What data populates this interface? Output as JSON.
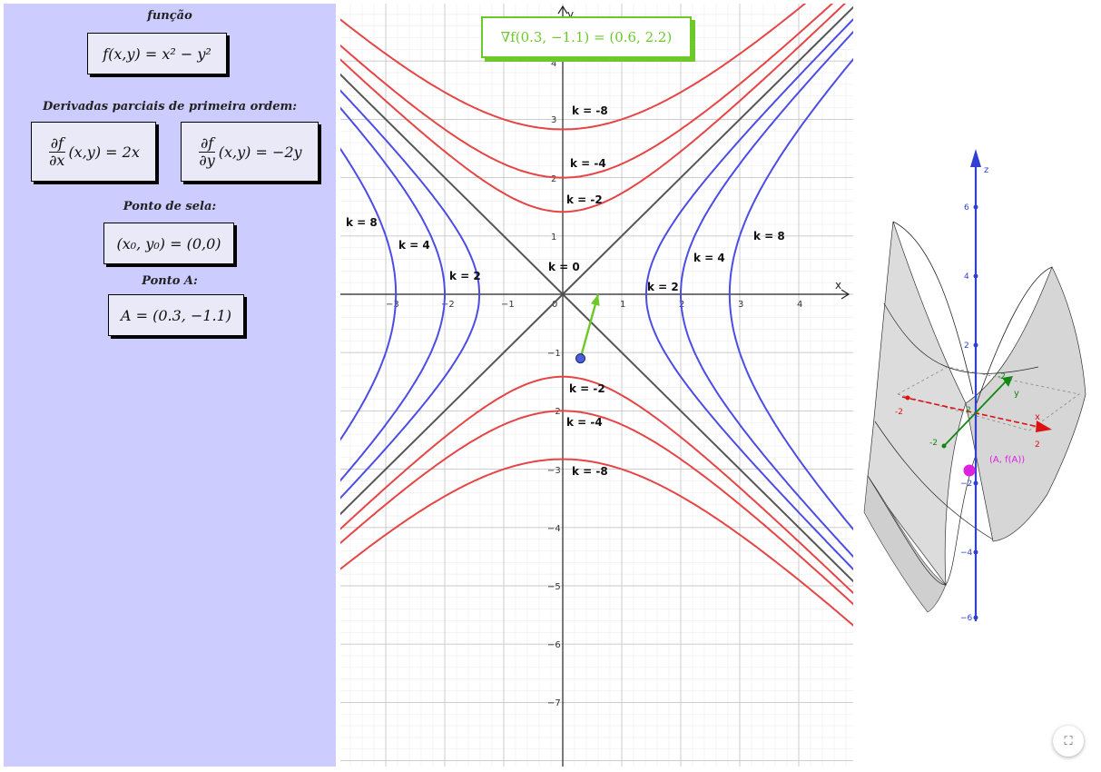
{
  "left_panel": {
    "caption_function": "função",
    "function_formula": "f(x,y) = x² − y²",
    "caption_partials": "Derivadas parciais de primeira ordem:",
    "partial_x": {
      "num": "∂f",
      "den": "∂x",
      "rest": "(x,y) = 2x"
    },
    "partial_y": {
      "num": "∂f",
      "den": "∂y",
      "rest": "(x,y) = −2y"
    },
    "caption_saddle": "Ponto de sela:",
    "saddle_formula": "(x₀, y₀) = (0,0)",
    "caption_point_a": "Ponto A:",
    "point_a_formula": "A = (0.3, −1.1)"
  },
  "graph2d": {
    "gradient_label": "∇f(0.3, −1.1)  = (0.6, 2.2)",
    "axis_x_label": "x",
    "axis_y_label": "y",
    "x_ticks": [
      "−3",
      "−2",
      "−1",
      "0",
      "1",
      "2",
      "3",
      "4"
    ],
    "y_ticks": [
      "4",
      "3",
      "2",
      "1",
      "−1",
      "−2",
      "−3",
      "−4",
      "−5",
      "−6",
      "−7"
    ],
    "level_labels": [
      "k = -8",
      "k = -4",
      "k = -2",
      "k = 8",
      "k = 4",
      "k = 2",
      "k = 0",
      "k = 2",
      "k = 4",
      "k = 8",
      "k = -2",
      "k = -4",
      "k = -8"
    ],
    "colors": {
      "positive": "#4c4ce6",
      "negative": "#e64545",
      "zero": "#555555",
      "gradient": "#6dc82a",
      "point": "#4c5fd6"
    },
    "point_a": {
      "x": 0.3,
      "y": -1.1
    },
    "gradient": {
      "x": 0.6,
      "y": 2.2
    }
  },
  "view3d": {
    "axis_z_label": "z",
    "axis_x_label": "x",
    "axis_y_label": "y",
    "z_ticks": [
      "6",
      "4",
      "2",
      "−2",
      "−4",
      "−6"
    ],
    "xy_ticks": [
      "-2",
      "2",
      "-2",
      "-2",
      "2"
    ],
    "point_label": "(A, f(A))",
    "colors": {
      "z_axis": "#2f3fd0",
      "x_axis": "#dd1111",
      "y_axis": "#118811",
      "point": "#e020e0"
    }
  },
  "controls": {
    "fullscreen_icon": "⛶"
  }
}
